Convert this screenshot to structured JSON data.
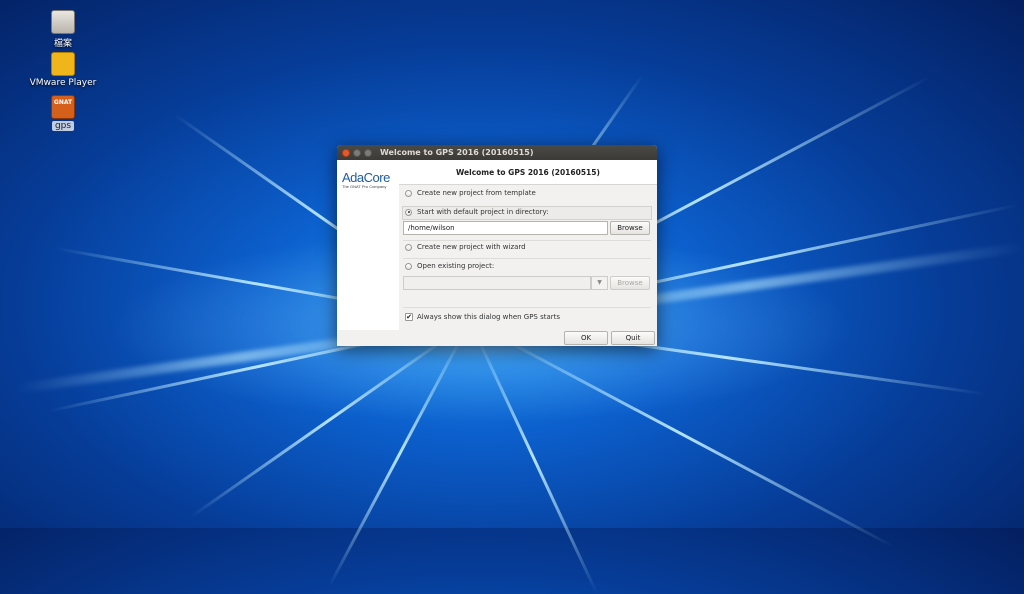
{
  "desktop": {
    "icons": [
      {
        "label": "檔案",
        "icon": "files-icon"
      },
      {
        "label": "VMware Player",
        "icon": "vmware-icon"
      },
      {
        "label": "gps",
        "icon": "gnat-icon",
        "glyph_text": "GNAT"
      }
    ]
  },
  "window": {
    "title": "Welcome to GPS 2016 (20160515)",
    "header": "Welcome to GPS 2016 (20160515)",
    "logo": {
      "name": "AdaCore",
      "tagline": "The GNAT Pro Company"
    },
    "options": {
      "template": "Create new project from template",
      "default": "Start with default project in directory:",
      "wizard": "Create new project with wizard",
      "existing": "Open existing project:"
    },
    "directory_value": "/home/wilson",
    "existing_value": "",
    "browse_label": "Browse",
    "browse2_label": "Browse",
    "always_show_label": "Always show this dialog when GPS starts",
    "always_show_checked": true,
    "ok_label": "OK",
    "quit_label": "Quit"
  },
  "colors": {
    "accent": "#e35a2e",
    "titlebar": "#3c3b37",
    "logo": "#1f5aa8"
  }
}
